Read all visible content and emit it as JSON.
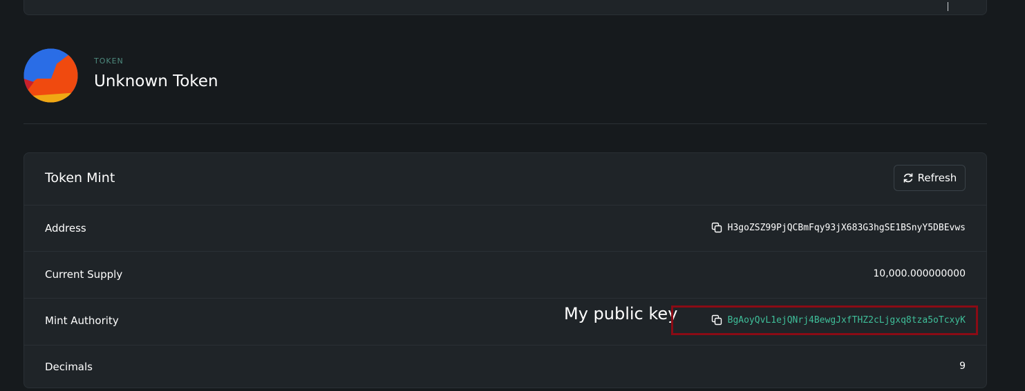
{
  "token": {
    "kicker": "TOKEN",
    "name": "Unknown Token"
  },
  "mint_card": {
    "title": "Token Mint",
    "refresh_label": "Refresh",
    "rows": [
      {
        "label": "Address",
        "value": "H3goZSZ99PjQCBmFqy93jX683G3hgSE1BSnyY5DBEvws"
      },
      {
        "label": "Current Supply",
        "value": "10,000.000000000"
      },
      {
        "label": "Mint Authority",
        "value": "BgAoyQvL1ejQNrj4BewgJxfTHZ2cLjgxq8tza5oTcxyK"
      },
      {
        "label": "Decimals",
        "value": "9"
      }
    ]
  },
  "annotation": {
    "text": "My public key",
    "box_color": "#8b0b15"
  },
  "colors": {
    "background": "#161a1d",
    "card": "#1f2428",
    "accent_green": "#3fbf9a"
  }
}
